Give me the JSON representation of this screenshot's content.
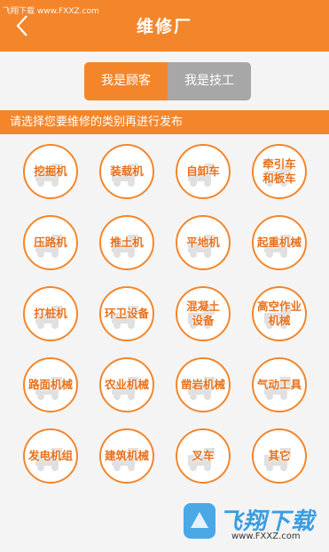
{
  "watermark_top": "飞翔下载 www.FXXZ.com",
  "header": {
    "title": "维修厂"
  },
  "toggle": {
    "customer_label": "我是顾客",
    "technician_label": "我是技工",
    "selected": "customer"
  },
  "banner": {
    "text": "请选择您要维修的类别再进行发布"
  },
  "categories": [
    "挖掘机",
    "装载机",
    "自卸车",
    "牵引车\n和板车",
    "压路机",
    "推土机",
    "平地机",
    "起重机械",
    "打桩机",
    "环卫设备",
    "混凝土\n设备",
    "高空作业\n机械",
    "路面机械",
    "农业机械",
    "凿岩机械",
    "气动工具",
    "发电机组",
    "建筑机械",
    "叉车",
    "其它"
  ],
  "logo": {
    "text": "飞翔下载",
    "url": "www.FXXZ.com"
  },
  "colors": {
    "accent": "#f3862b",
    "inactive": "#a7a7a7",
    "background": "#f4f4f4"
  }
}
